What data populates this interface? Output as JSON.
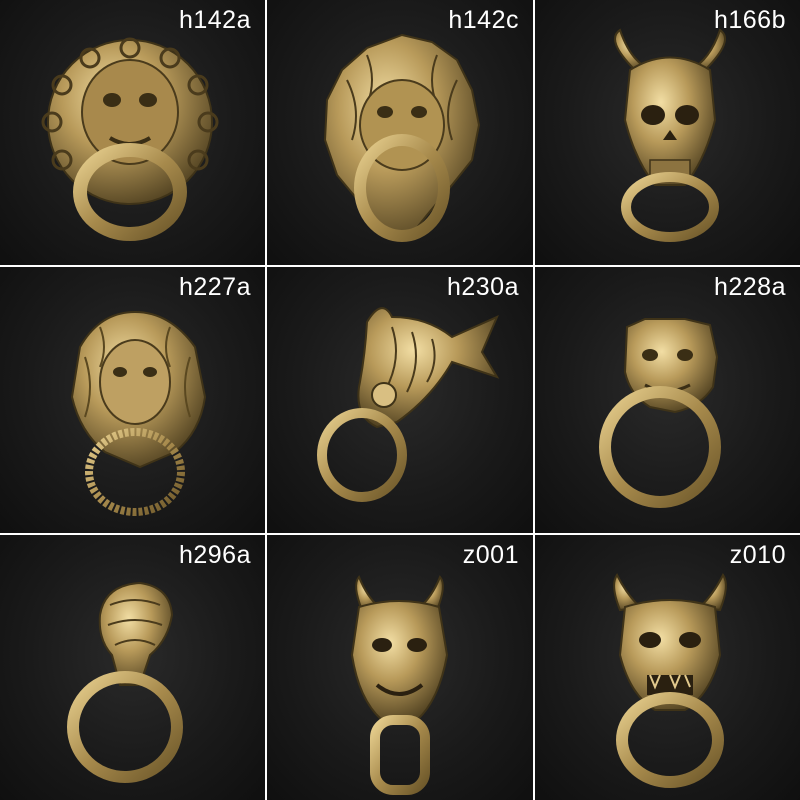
{
  "colors": {
    "background": "#161616",
    "brass_light": "#e2c98c",
    "brass_mid": "#b6995a",
    "brass_dark": "#5e4c28",
    "label": "#ffffff"
  },
  "items": [
    {
      "code": "h142a",
      "icon": "lion-door-knocker-with-cloud-rim-icon"
    },
    {
      "code": "h142c",
      "icon": "lion-mane-knocker-icon"
    },
    {
      "code": "h166b",
      "icon": "horned-skull-ring-icon"
    },
    {
      "code": "h227a",
      "icon": "lion-head-rope-ring-icon"
    },
    {
      "code": "h230a",
      "icon": "koi-fish-ring-icon"
    },
    {
      "code": "h228a",
      "icon": "foo-dog-ring-icon"
    },
    {
      "code": "h296a",
      "icon": "snake-head-ring-icon"
    },
    {
      "code": "z001",
      "icon": "oni-mask-bone-ring-icon"
    },
    {
      "code": "z010",
      "icon": "hannya-mask-ring-icon"
    }
  ]
}
